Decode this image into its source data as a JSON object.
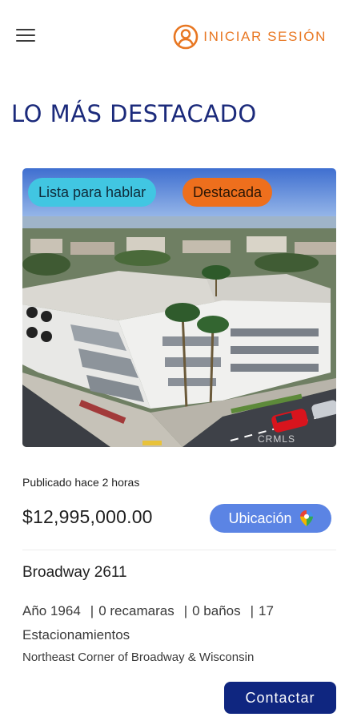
{
  "header": {
    "menu_icon": "hamburger-menu-icon",
    "login_icon": "user-circle-icon",
    "login_label": "INICIAR SESIÓN",
    "accent_color": "#e87722"
  },
  "section": {
    "title": "LO MÁS DESTACADO",
    "title_color": "#1b2a7b"
  },
  "listing": {
    "badges": {
      "ready": "Lista para hablar",
      "featured": "Destacada"
    },
    "image_watermark": "CRMLS",
    "posted": "Publicado hace 2 horas",
    "price": "$12,995,000.00",
    "location_button": "Ubicación",
    "location_icon": "map-pin-icon",
    "address": "Broadway 2611",
    "specs": {
      "year": "Año 1964",
      "bedrooms": "0 recamaras",
      "bathrooms": "0 baños",
      "parking": "17 Estacionamientos"
    },
    "cross_streets": "Northeast Corner of Broadway & Wisconsin",
    "contact_button": "Contactar",
    "contact_color": "#0f2680"
  }
}
